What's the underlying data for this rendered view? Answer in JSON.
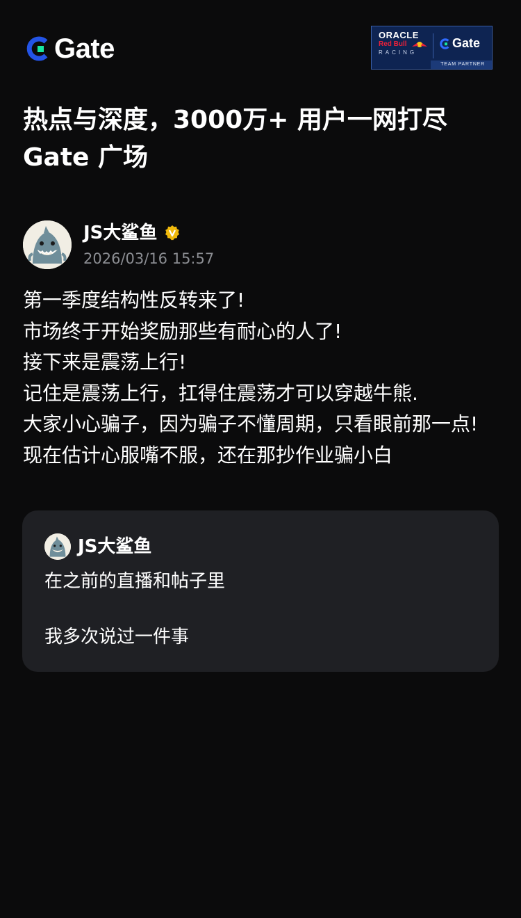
{
  "header": {
    "logo_text": "Gate",
    "logo_icon": "gate-logo-icon",
    "partner_badge": {
      "oracle": "ORACLE",
      "red_bull": "Red Bull",
      "racing": "RACING",
      "gate": "Gate",
      "team_partner": "TEAM PARTNER"
    }
  },
  "headline": {
    "line1": "热点与深度，3000万+ 用户一网打尽",
    "line2": "Gate 广场"
  },
  "post": {
    "author": "JS大鲨鱼",
    "verified_icon": "verified-badge-icon",
    "time": "2026/03/16 15:57",
    "lines": [
      "第一季度结构性反转来了!",
      "市场终于开始奖励那些有耐心的人了!",
      "接下来是震荡上行!",
      "记住是震荡上行，扛得住震荡才可以穿越牛熊.",
      "大家小心骗子，因为骗子不懂周期，只看眼前那一点!",
      "现在估计心服嘴不服，还在那抄作业骗小白"
    ]
  },
  "quote": {
    "author": "JS大鲨鱼",
    "line1": "在之前的直播和帖子里",
    "line2": "我多次说过一件事"
  },
  "colors": {
    "background": "#0b0b0c",
    "card": "#1f2024",
    "gate_blue": "#2354e6",
    "gate_green": "#17e6a1",
    "verified_gold": "#f0b90b",
    "muted_text": "#8b8d92"
  }
}
